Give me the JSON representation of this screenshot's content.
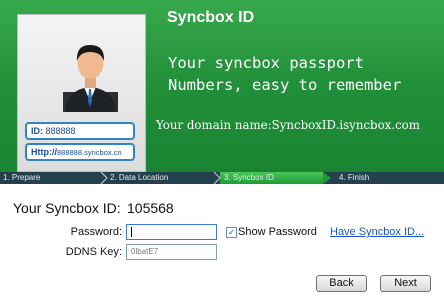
{
  "banner": {
    "title": "Syncbox ID",
    "tagline": "Your syncbox passport\nNumbers, easy to remember",
    "domain_text": "Your domain name:SyncboxID.isyncbox.com",
    "card": {
      "id_label": "ID:",
      "id_value": "888888",
      "url_label": "Http://",
      "url_value": "888888.syncbox.cn"
    }
  },
  "steps": [
    {
      "label": "1. Prepare"
    },
    {
      "label": "2. Data Location"
    },
    {
      "label": "3. Syncbox ID",
      "active": true
    },
    {
      "label": "4. Finish"
    }
  ],
  "form": {
    "syncbox_id_label": "Your Syncbox ID:",
    "syncbox_id_value": "105568",
    "password_label": "Password:",
    "password_value": "",
    "show_password_label": "Show Password",
    "show_password_checked": true,
    "have_link": "Have Syncbox ID...",
    "ddns_label": "DDNS Key:",
    "ddns_value": "0lbatE7"
  },
  "buttons": {
    "back": "Back",
    "next": "Next"
  },
  "colors": {
    "banner_green": "#22913a",
    "step_bar": "#24404c",
    "active_step": "#2fb043",
    "link": "#1a57c4"
  }
}
